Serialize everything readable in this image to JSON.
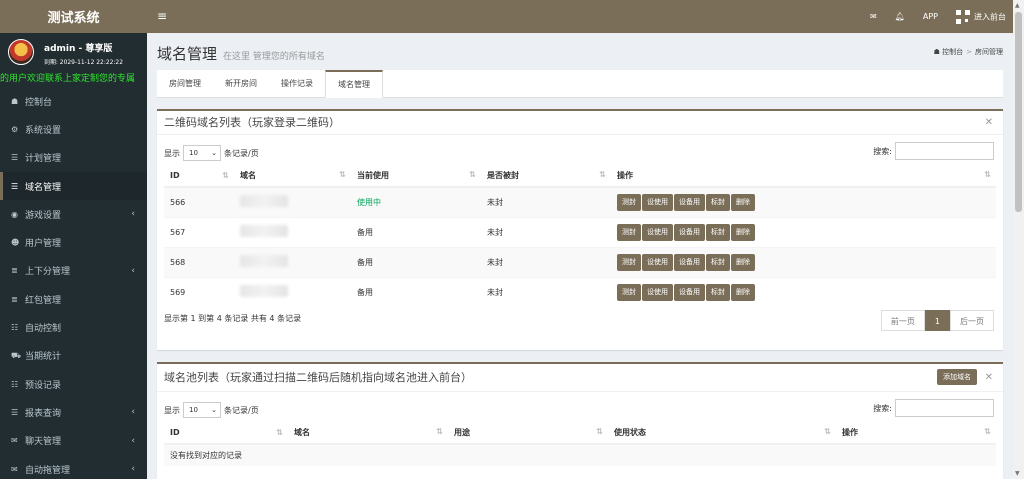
{
  "brand": "测试系统",
  "user": {
    "name": "admin - 尊享版",
    "expire": "到期: 2029-11-12 22:22:22",
    "marquee": "的用户欢迎联系上家定制您的专属"
  },
  "sidebar": {
    "items": [
      {
        "icon": "☗",
        "label": "控制台",
        "arrow": ""
      },
      {
        "icon": "⚙",
        "label": "系统设置",
        "arrow": ""
      },
      {
        "icon": "☰",
        "label": "计划管理",
        "arrow": ""
      },
      {
        "icon": "☰",
        "label": "域名管理",
        "arrow": "",
        "active": true
      },
      {
        "icon": "◉",
        "label": "游戏设置",
        "arrow": "‹"
      },
      {
        "icon": "☻",
        "label": "用户管理",
        "arrow": ""
      },
      {
        "icon": "≣",
        "label": "上下分管理",
        "arrow": "‹"
      },
      {
        "icon": "≣",
        "label": "红包管理",
        "arrow": ""
      },
      {
        "icon": "☷",
        "label": "自动控制",
        "arrow": ""
      },
      {
        "icon": "⛟",
        "label": "当期统计",
        "arrow": ""
      },
      {
        "icon": "☷",
        "label": "预设记录",
        "arrow": ""
      },
      {
        "icon": "☰",
        "label": "报表查询",
        "arrow": "‹"
      },
      {
        "icon": "✉",
        "label": "聊天管理",
        "arrow": "‹"
      },
      {
        "icon": "✉",
        "label": "自动拖管理",
        "arrow": "‹"
      }
    ]
  },
  "topbar": {
    "menu_icon": "≡",
    "mail_icon": "✉",
    "bell_icon": "🔔︎",
    "app_label": "APP",
    "enter_label": "进入前台"
  },
  "header": {
    "title": "域名管理",
    "subtitle": "在这里 管理您的所有域名",
    "breadcrumb_home": "控制台",
    "breadcrumb_current": "房间管理"
  },
  "tabs": [
    "房间管理",
    "新开房间",
    "操作记录",
    "域名管理"
  ],
  "box1": {
    "title": "二维码域名列表（玩家登录二维码）",
    "show_prefix": "显示",
    "page_size": "10",
    "show_suffix": "条记录/页",
    "search_label": "搜索:",
    "columns": [
      "ID",
      "域名",
      "当前使用",
      "是否被封",
      "操作"
    ],
    "rows": [
      {
        "id": "566",
        "status": "使用中",
        "blocked": "未封",
        "in_use": true
      },
      {
        "id": "567",
        "status": "备用",
        "blocked": "未封",
        "in_use": false
      },
      {
        "id": "568",
        "status": "备用",
        "blocked": "未封",
        "in_use": false
      },
      {
        "id": "569",
        "status": "备用",
        "blocked": "未封",
        "in_use": false
      }
    ],
    "actions": [
      "测封",
      "设使用",
      "设备用",
      "标封",
      "删除"
    ],
    "info": "显示第 1 到第 4 条记录 共有 4 条记录",
    "prev": "前一页",
    "page": "1",
    "next": "后一页"
  },
  "box2": {
    "title": "域名池列表（玩家通过扫描二维码后随机指向域名池进入前台）",
    "add_label": "添加域名",
    "show_prefix": "显示",
    "page_size": "10",
    "show_suffix": "条记录/页",
    "search_label": "搜索:",
    "columns": [
      "ID",
      "域名",
      "用途",
      "使用状态",
      "操作"
    ],
    "empty": "没有找到对应的记录"
  },
  "colors": {
    "accent": "#7a6e58",
    "sidebar": "#222d32",
    "green": "#00a65a"
  }
}
